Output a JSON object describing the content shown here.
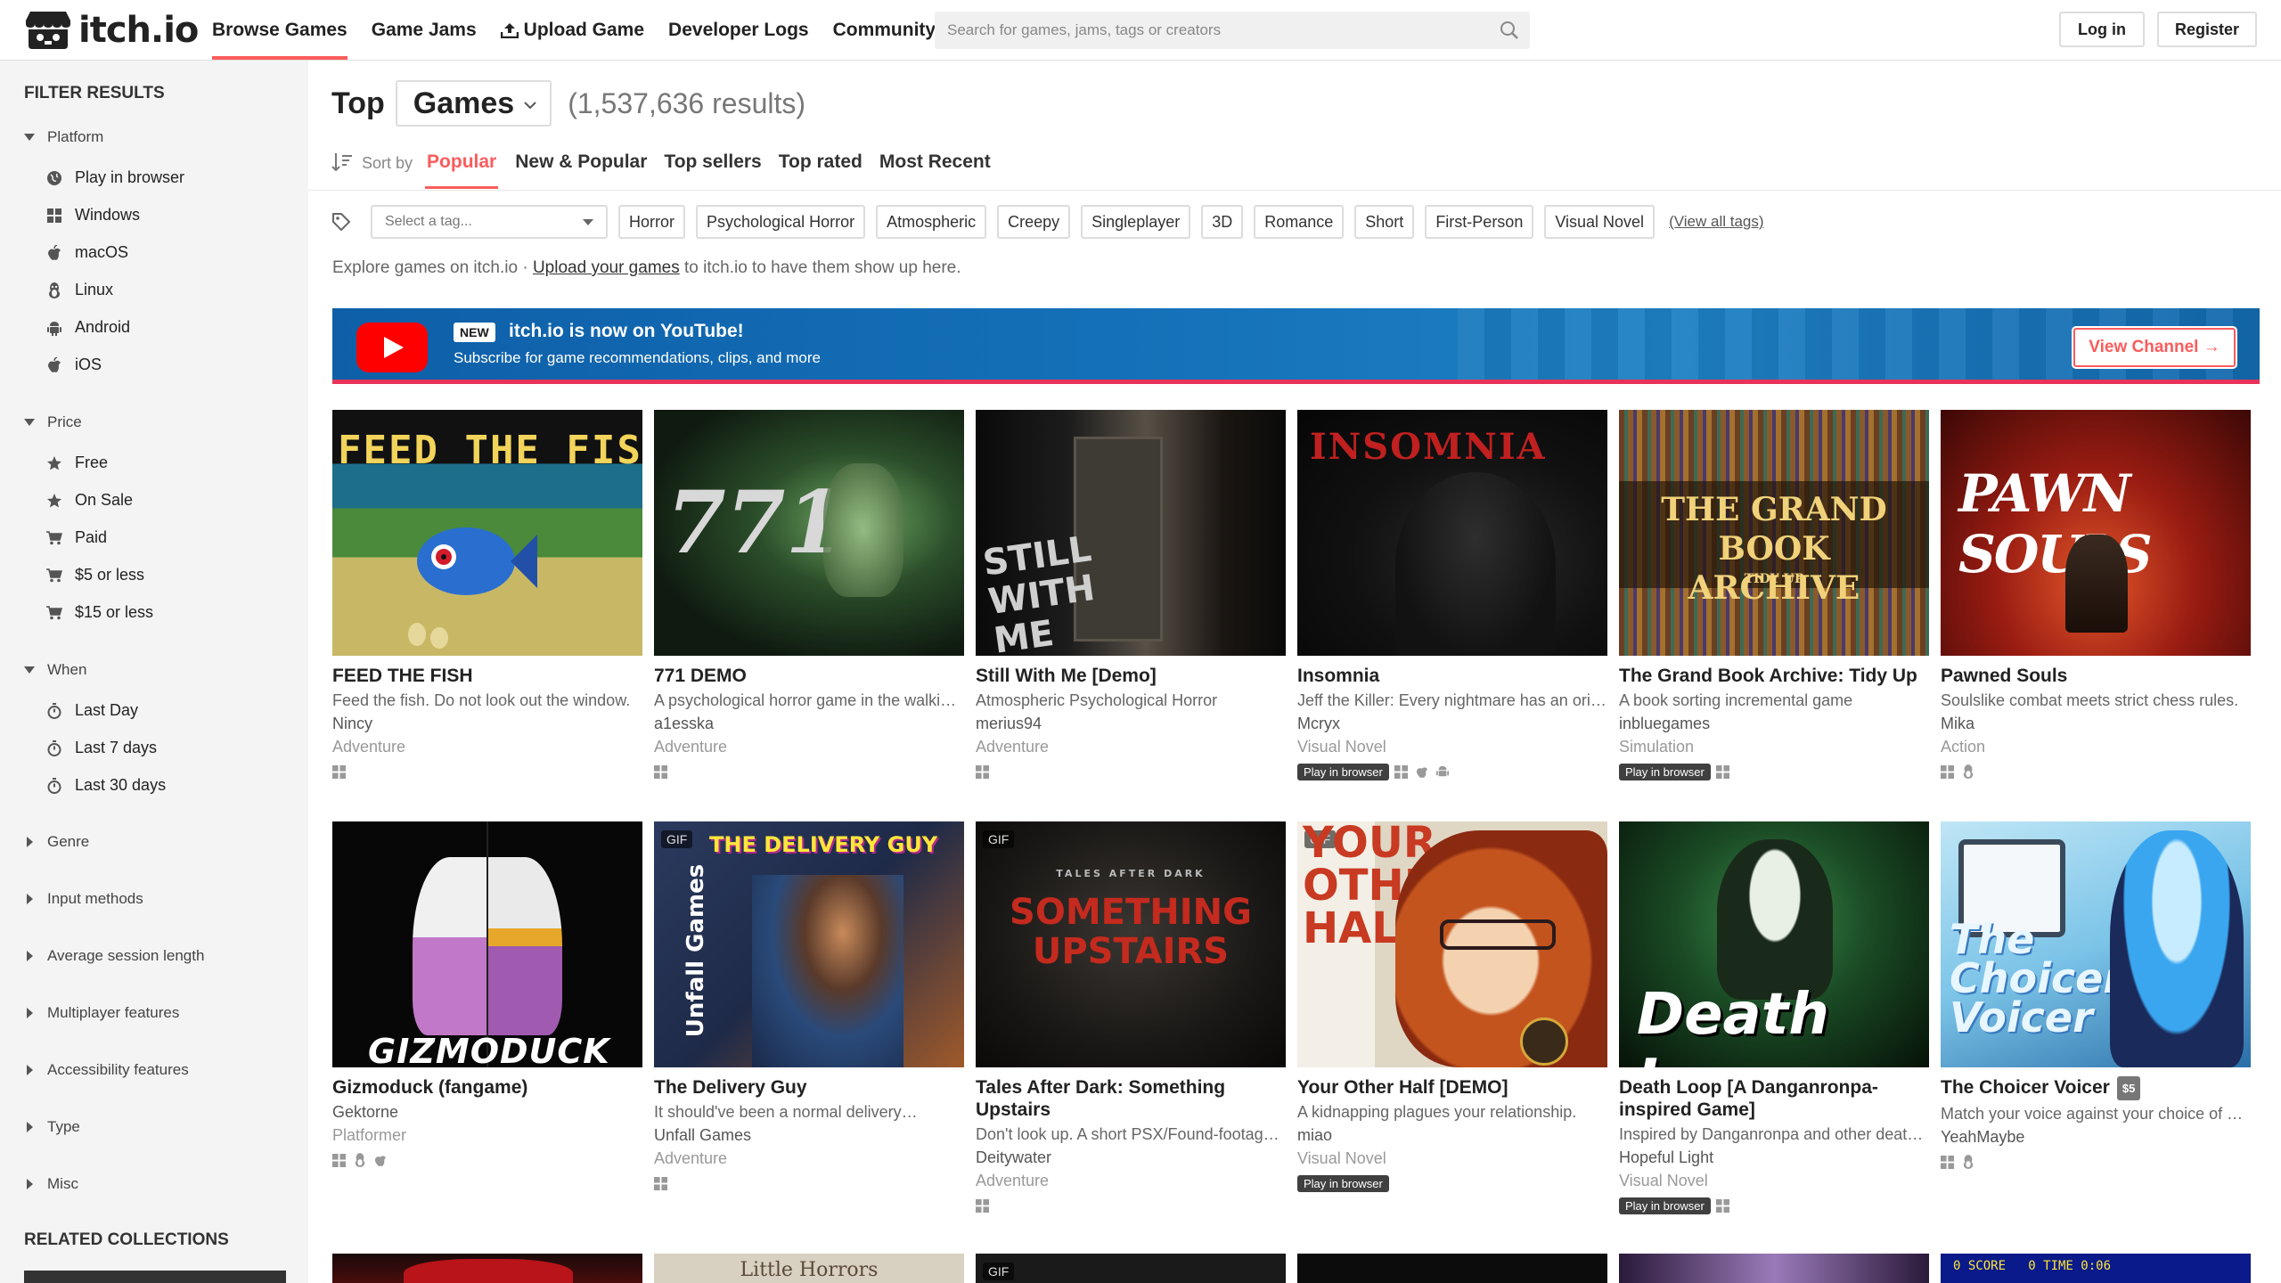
{
  "header": {
    "logo_text": "itch.io",
    "nav": [
      "Browse Games",
      "Game Jams",
      "Upload Game",
      "Developer Logs",
      "Community"
    ],
    "search_placeholder": "Search for games, jams, tags or creators",
    "login": "Log in",
    "register": "Register"
  },
  "sidebar": {
    "title": "FILTER RESULTS",
    "groups": {
      "platform": "Platform",
      "price": "Price",
      "when": "When",
      "genre": "Genre",
      "input": "Input methods",
      "session": "Average session length",
      "multiplayer": "Multiplayer features",
      "accessibility": "Accessibility features",
      "type": "Type",
      "misc": "Misc"
    },
    "platform_items": [
      "Play in browser",
      "Windows",
      "macOS",
      "Linux",
      "Android",
      "iOS"
    ],
    "price_items": [
      "Free",
      "On Sale",
      "Paid",
      "$5 or less",
      "$15 or less"
    ],
    "when_items": [
      "Last Day",
      "Last 7 days",
      "Last 30 days"
    ],
    "related": "RELATED COLLECTIONS"
  },
  "main": {
    "title_top": "Top",
    "title_select": "Games",
    "result_count": "(1,537,636 results)",
    "sort_label": "Sort by",
    "sort_tabs": [
      "Popular",
      "New & Popular",
      "Top sellers",
      "Top rated",
      "Most Recent"
    ],
    "tag_placeholder": "Select a tag...",
    "tags": [
      "Horror",
      "Psychological Horror",
      "Atmospheric",
      "Creepy",
      "Singleplayer",
      "3D",
      "Romance",
      "Short",
      "First-Person",
      "Visual Novel"
    ],
    "view_all_tags": "(View all tags)",
    "explore_prefix": "Explore games on itch.io · ",
    "explore_link": "Upload your games",
    "explore_suffix": " to itch.io to have them show up here."
  },
  "banner": {
    "badge": "NEW",
    "headline": "itch.io is now on YouTube!",
    "sub": "Subscribe for game recommendations, clips, and more",
    "button": "View Channel →"
  },
  "games": [
    {
      "title": "FEED THE FISH",
      "desc": "Feed the fish. Do not look out the window.",
      "author": "Nincy",
      "genre": "Adventure",
      "thumb_text": "FEED THE FISH"
    },
    {
      "title": "771 DEMO",
      "desc": "A psychological horror game in the walki…",
      "author": "a1esska",
      "genre": "Adventure",
      "thumb_text": "771"
    },
    {
      "title": "Still With Me [Demo]",
      "desc": "Atmospheric Psychological Horror",
      "author": "merius94",
      "genre": "Adventure",
      "thumb_text": "STILL WITH ME"
    },
    {
      "title": "Insomnia",
      "desc": "Jeff the Killer: Every nightmare has an ori…",
      "author": "Mcryx",
      "genre": "Visual Novel",
      "thumb_text": "INSOMNIA",
      "play_in_browser": "Play in browser"
    },
    {
      "title": "The Grand Book Archive: Tidy Up",
      "desc": "A book sorting incremental game",
      "author": "inbluegames",
      "genre": "Simulation",
      "thumb_text": "THE GRAND BOOK ARCHIVE",
      "thumb_sub": "TIDY UP",
      "play_in_browser": "Play in browser"
    },
    {
      "title": "Pawned Souls",
      "desc": "Soulslike combat meets strict chess rules.",
      "author": "Mika",
      "genre": "Action",
      "thumb_text": "PAWN SOULS"
    },
    {
      "title": "Gizmoduck (fangame)",
      "desc": "",
      "author": "Gektorne",
      "genre": "Platformer",
      "thumb_text": "GIZMODUCK"
    },
    {
      "title": "The Delivery Guy",
      "desc": "It should've been a normal delivery…",
      "author": "Unfall Games",
      "genre": "Adventure",
      "thumb_text": "THE DELIVERY GUY",
      "thumb_side": "Unfall Games",
      "gif": "GIF"
    },
    {
      "title": "Tales After Dark: Something Upstairs",
      "desc": "Don't look up. A short PSX/Found-footag…",
      "author": "Deitywater",
      "genre": "Adventure",
      "thumb_text": "SOMETHING UPSTAIRS",
      "thumb_sub": "TALES AFTER DARK",
      "gif": "GIF"
    },
    {
      "title": "Your Other Half [DEMO]",
      "desc": "A kidnapping plagues your relationship.",
      "author": "miao",
      "genre": "Visual Novel",
      "thumb_text": "YOUR OTHER HALF",
      "gif": "GIF",
      "play_in_browser": "Play in browser"
    },
    {
      "title": "Death Loop [A Danganronpa-inspired Game]",
      "desc": "Inspired by Danganronpa and other deat…",
      "author": "Hopeful Light",
      "genre": "Visual Novel",
      "thumb_text": "Death Loop",
      "play_in_browser": "Play in browser"
    },
    {
      "title": "The Choicer Voicer",
      "price": "$5",
      "desc": "Match your voice against your choice of a…",
      "author": "YeahMaybe",
      "genre": "",
      "thumb_text": "The Choicer Voicer"
    }
  ],
  "bottom_row": [
    {
      "thumb_text": ""
    },
    {
      "thumb_text": "Little Horrors"
    },
    {
      "thumb_text": "",
      "gif": "GIF"
    },
    {
      "thumb_text": ""
    },
    {
      "thumb_text": ""
    },
    {
      "thumb_text": "0 SCORE   0 TIME 0:06"
    }
  ]
}
